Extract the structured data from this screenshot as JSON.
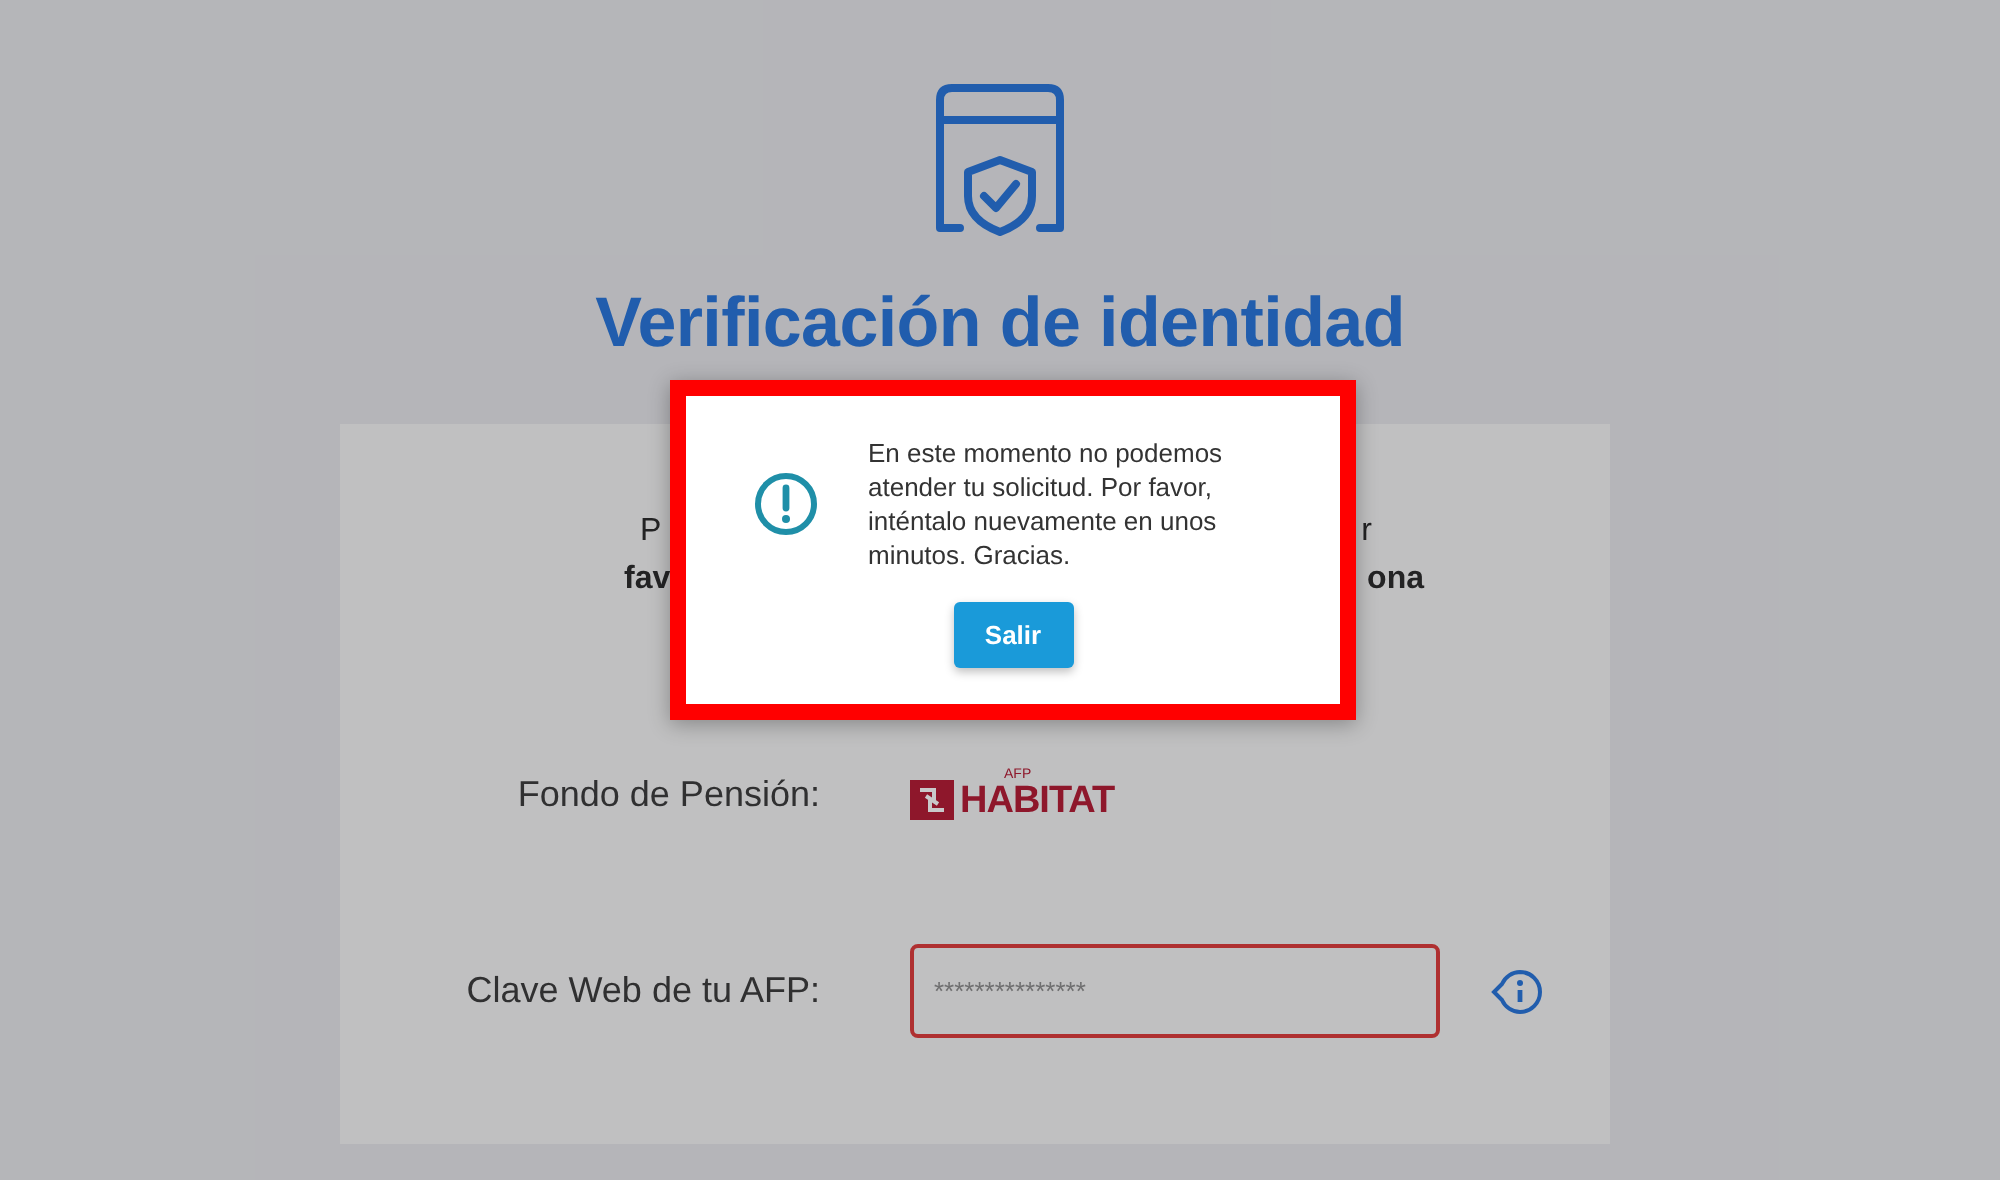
{
  "header": {
    "title": "Verificación de identidad"
  },
  "intro_lines": [
    {
      "left": "P",
      "right": "r",
      "bold": false
    },
    {
      "left": "fav",
      "right": "ona",
      "bold": true
    }
  ],
  "form": {
    "fields": [
      {
        "kind": "logo",
        "label": "Fondo de Pensión:",
        "logo_small": "AFP",
        "logo_text": "HABITAT"
      },
      {
        "kind": "password",
        "label": "Clave Web de tu AFP:",
        "placeholder": "***************",
        "invalid": true
      }
    ]
  },
  "modal": {
    "message": "En este momento no podemos atender tu solicitud. Por favor, inténtalo nuevamente en unos minutos. Gracias.",
    "button": "Salir",
    "highlighted": true
  }
}
